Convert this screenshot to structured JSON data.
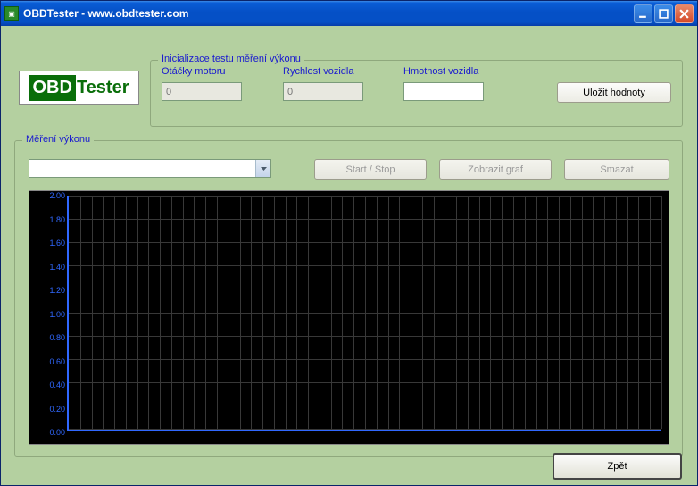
{
  "window": {
    "title": "OBDTester - www.obdtester.com",
    "logo": {
      "left": "OBD",
      "right": "Tester"
    }
  },
  "init": {
    "group_label": "Inicializace testu měření výkonu",
    "rpm_label": "Otáčky motoru",
    "rpm_value": "0",
    "speed_label": "Rychlost vozidla",
    "speed_value": "0",
    "mass_label": "Hmotnost vozidla",
    "mass_value": "",
    "save_label": "Uložit hodnoty"
  },
  "measure": {
    "group_label": "Měření výkonu",
    "combo_value": "",
    "start_stop_label": "Start / Stop",
    "graph_label": "Zobrazit graf",
    "clear_label": "Smazat"
  },
  "footer": {
    "back_label": "Zpět"
  },
  "chart_data": {
    "type": "line",
    "title": "",
    "xlabel": "",
    "ylabel": "",
    "ylim": [
      0,
      2.0
    ],
    "yticks": [
      2.0,
      1.8,
      1.6,
      1.4,
      1.2,
      1.0,
      0.8,
      0.6,
      0.4,
      0.2,
      0.0
    ],
    "series": []
  }
}
